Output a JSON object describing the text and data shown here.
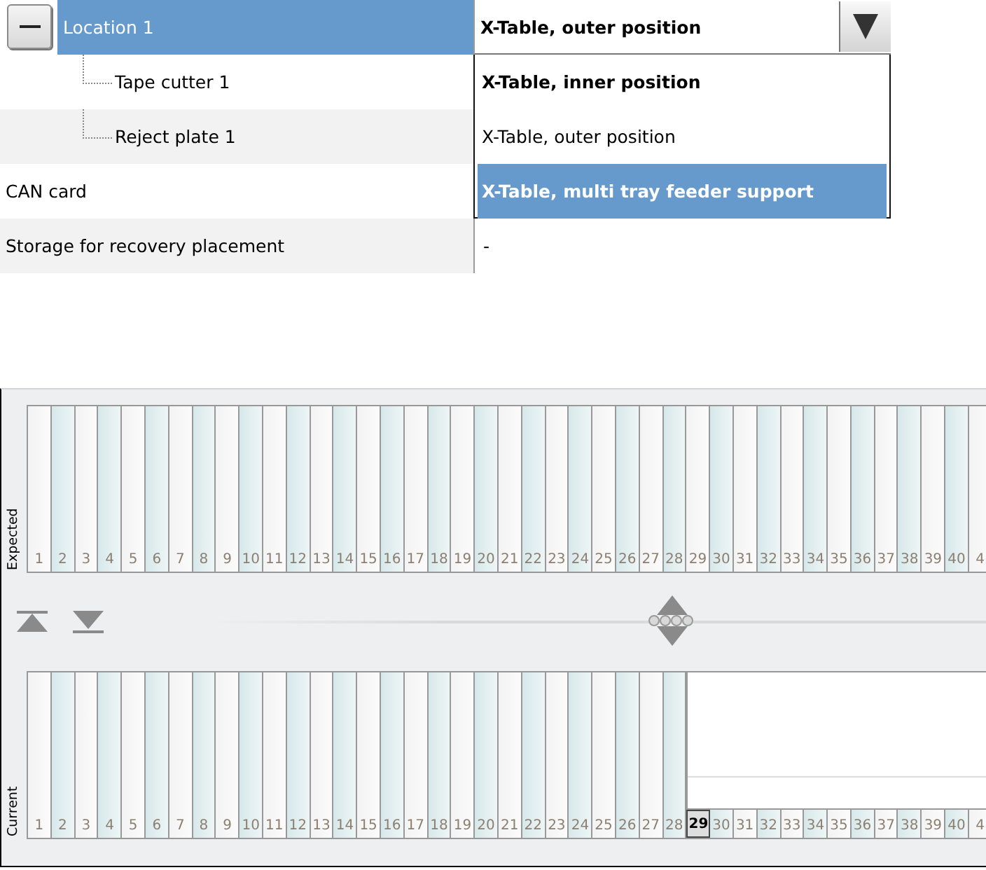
{
  "property_grid": {
    "rows": [
      {
        "label": "Location 1",
        "selected": true,
        "expanded": true,
        "value": "X-Table, outer position",
        "children": [
          {
            "label": "Tape cutter 1"
          },
          {
            "label": "Reject plate 1"
          }
        ]
      },
      {
        "label": "CAN card"
      },
      {
        "label": "Storage for recovery placement",
        "value": "-"
      }
    ]
  },
  "dropdown": {
    "options": [
      {
        "label": "X-Table, inner position",
        "default": true,
        "selected": false
      },
      {
        "label": "X-Table, outer position",
        "default": false,
        "selected": false
      },
      {
        "label": "X-Table, multi tray feeder support",
        "default": false,
        "selected": true
      }
    ]
  },
  "expected": {
    "title": "Expected",
    "slots": [
      {
        "label": "1"
      },
      {
        "label": "2"
      },
      {
        "label": "3"
      },
      {
        "label": "4"
      },
      {
        "label": "5"
      },
      {
        "label": "6"
      },
      {
        "label": "7"
      },
      {
        "label": "8"
      },
      {
        "label": "9"
      },
      {
        "label": "10"
      },
      {
        "label": "11"
      },
      {
        "label": "12"
      },
      {
        "label": "13"
      },
      {
        "label": "14"
      },
      {
        "label": "15"
      },
      {
        "label": "16"
      },
      {
        "label": "17"
      },
      {
        "label": "18"
      },
      {
        "label": "19"
      },
      {
        "label": "20"
      },
      {
        "label": "21"
      },
      {
        "label": "22"
      },
      {
        "label": "23"
      },
      {
        "label": "24"
      },
      {
        "label": "25"
      },
      {
        "label": "26"
      },
      {
        "label": "27"
      },
      {
        "label": "28"
      },
      {
        "label": "29"
      },
      {
        "label": "30"
      },
      {
        "label": "31"
      },
      {
        "label": "32"
      },
      {
        "label": "33"
      },
      {
        "label": "34"
      },
      {
        "label": "35"
      },
      {
        "label": "36"
      },
      {
        "label": "37"
      },
      {
        "label": "38"
      },
      {
        "label": "39"
      },
      {
        "label": "40"
      },
      {
        "label": "4"
      }
    ]
  },
  "current": {
    "title": "Current",
    "slots": [
      {
        "label": "1",
        "filled": true,
        "selected": false
      },
      {
        "label": "2",
        "filled": true,
        "selected": false
      },
      {
        "label": "3",
        "filled": true,
        "selected": false
      },
      {
        "label": "4",
        "filled": true,
        "selected": false
      },
      {
        "label": "5",
        "filled": true,
        "selected": false
      },
      {
        "label": "6",
        "filled": true,
        "selected": false
      },
      {
        "label": "7",
        "filled": true,
        "selected": false
      },
      {
        "label": "8",
        "filled": true,
        "selected": false
      },
      {
        "label": "9",
        "filled": true,
        "selected": false
      },
      {
        "label": "10",
        "filled": true,
        "selected": false
      },
      {
        "label": "11",
        "filled": true,
        "selected": false
      },
      {
        "label": "12",
        "filled": true,
        "selected": false
      },
      {
        "label": "13",
        "filled": true,
        "selected": false
      },
      {
        "label": "14",
        "filled": true,
        "selected": false
      },
      {
        "label": "15",
        "filled": true,
        "selected": false
      },
      {
        "label": "16",
        "filled": true,
        "selected": false
      },
      {
        "label": "17",
        "filled": true,
        "selected": false
      },
      {
        "label": "18",
        "filled": true,
        "selected": false
      },
      {
        "label": "19",
        "filled": true,
        "selected": false
      },
      {
        "label": "20",
        "filled": true,
        "selected": false
      },
      {
        "label": "21",
        "filled": true,
        "selected": false
      },
      {
        "label": "22",
        "filled": true,
        "selected": false
      },
      {
        "label": "23",
        "filled": true,
        "selected": false
      },
      {
        "label": "24",
        "filled": true,
        "selected": false
      },
      {
        "label": "25",
        "filled": true,
        "selected": false
      },
      {
        "label": "26",
        "filled": true,
        "selected": false
      },
      {
        "label": "27",
        "filled": true,
        "selected": false
      },
      {
        "label": "28",
        "filled": true,
        "selected": false
      },
      {
        "label": "29",
        "filled": false,
        "selected": true
      },
      {
        "label": "30",
        "filled": false,
        "selected": false
      },
      {
        "label": "31",
        "filled": false,
        "selected": false
      },
      {
        "label": "32",
        "filled": false,
        "selected": false
      },
      {
        "label": "33",
        "filled": false,
        "selected": false
      },
      {
        "label": "34",
        "filled": false,
        "selected": false
      },
      {
        "label": "35",
        "filled": false,
        "selected": false
      },
      {
        "label": "36",
        "filled": false,
        "selected": false
      },
      {
        "label": "37",
        "filled": false,
        "selected": false
      },
      {
        "label": "38",
        "filled": false,
        "selected": false
      },
      {
        "label": "39",
        "filled": false,
        "selected": false
      },
      {
        "label": "40",
        "filled": false,
        "selected": false
      },
      {
        "label": "4",
        "filled": false,
        "selected": false
      }
    ]
  }
}
